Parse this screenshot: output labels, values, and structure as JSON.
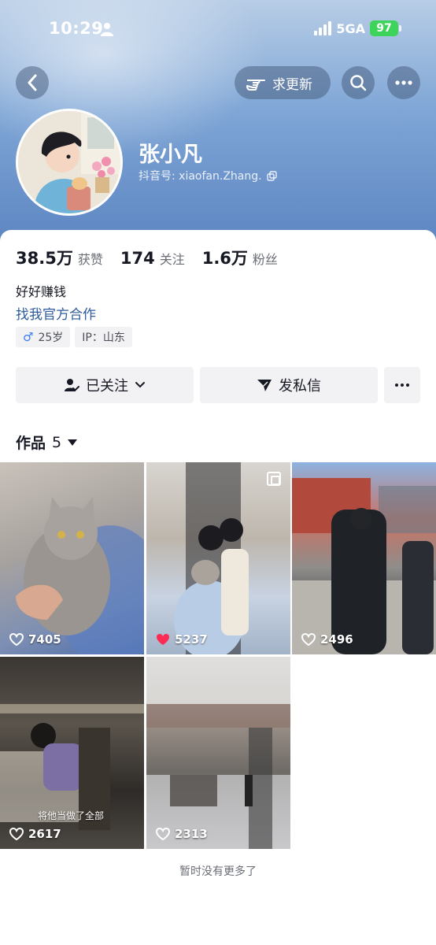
{
  "status_bar": {
    "time": "10:29",
    "network": "5GA",
    "battery": "97"
  },
  "top_bar": {
    "update_label": "求更新"
  },
  "profile": {
    "nickname": "张小凡",
    "douyin_id": "抖音号: xiaofan.Zhang.",
    "stats": [
      {
        "value": "38.5万",
        "label": "获赞"
      },
      {
        "value": "174",
        "label": "关注"
      },
      {
        "value": "1.6万",
        "label": "粉丝"
      }
    ],
    "bio": "好好赚钱",
    "cooperation_link": "找我官方合作",
    "tags": {
      "age": "25岁",
      "ip": "IP：山东"
    }
  },
  "actions": {
    "follow_label": "已关注",
    "message_label": "发私信"
  },
  "works": {
    "title": "作品",
    "count": "5",
    "items": [
      {
        "likes": "7405",
        "liked": false,
        "caption": ""
      },
      {
        "likes": "5237",
        "liked": true,
        "caption": ""
      },
      {
        "likes": "2496",
        "liked": false,
        "caption": ""
      },
      {
        "likes": "2617",
        "liked": false,
        "caption": "将他当做了全部"
      },
      {
        "likes": "2313",
        "liked": false,
        "caption": ""
      }
    ]
  },
  "footer": {
    "no_more": "暂时没有更多了"
  },
  "colors": {
    "link": "#2f5b9c",
    "liked_heart": "#fe2c55",
    "battery": "#3ed35a"
  }
}
